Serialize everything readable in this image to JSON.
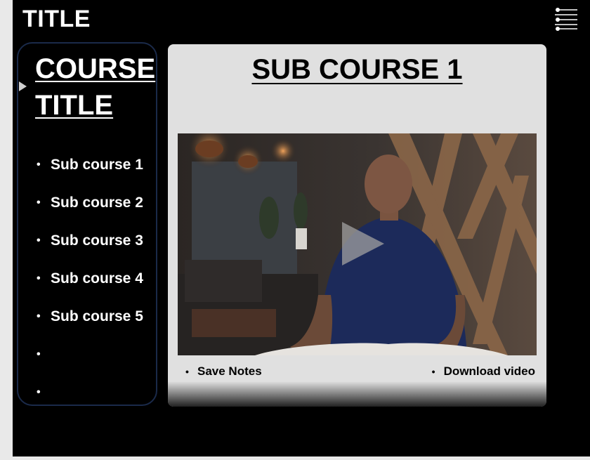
{
  "app": {
    "title": "TITLE"
  },
  "header": {
    "menu_icon": "menu-list-icon"
  },
  "sidebar": {
    "course_title_line1": "COURSE",
    "course_title_line2": "TITLE",
    "toggle_icon": "triangle-right-icon",
    "items": [
      {
        "label": "Sub course 1"
      },
      {
        "label": "Sub course 2"
      },
      {
        "label": "Sub course 3"
      },
      {
        "label": "Sub course 4"
      },
      {
        "label": "Sub course 5"
      },
      {
        "label": ""
      },
      {
        "label": ""
      }
    ]
  },
  "main": {
    "title": "SUB COURSE 1",
    "video": {
      "play_icon": "play-icon"
    },
    "actions": {
      "save_notes": "Save Notes",
      "download_video": "Download video"
    }
  },
  "colors": {
    "background": "#000000",
    "card": "#e0e0e0",
    "sidebar_border": "#1a2a4a",
    "text_light": "#ffffff",
    "text_dark": "#000000"
  }
}
